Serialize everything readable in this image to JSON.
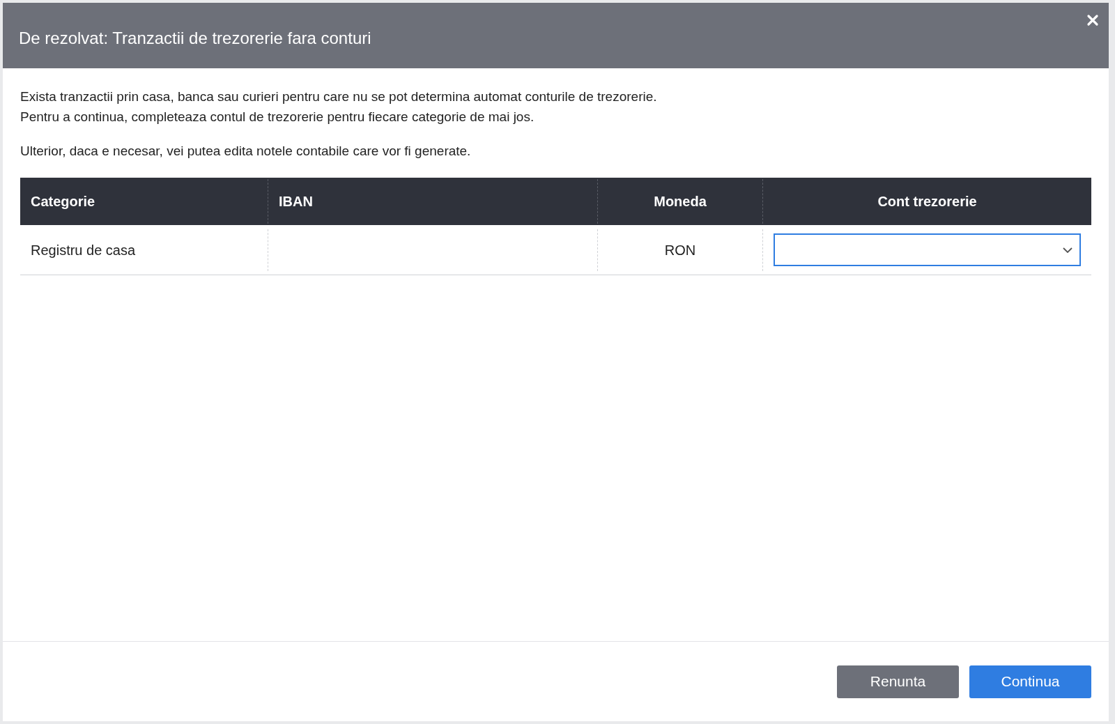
{
  "dialog": {
    "title": "De rezolvat: Tranzactii de trezorerie fara conturi"
  },
  "intro": [
    "Exista tranzactii prin casa, banca sau curieri pentru care nu se pot determina automat conturile de trezorerie.",
    "Pentru a continua, completeaza contul de trezorerie pentru fiecare categorie de mai jos."
  ],
  "note": "Ulterior, daca e necesar, vei putea edita notele contabile care vor fi generate.",
  "table": {
    "columns": [
      "Categorie",
      "IBAN",
      "Moneda",
      "Cont trezorerie"
    ],
    "rows": [
      {
        "categorie": "Registru de casa",
        "moneda": "RON",
        "cont": {
          "focused": true
        }
      }
    ]
  },
  "buttons": [
    {
      "label": "Renunta",
      "kind": "secondary"
    },
    {
      "label": "Continua",
      "kind": "primary"
    }
  ]
}
